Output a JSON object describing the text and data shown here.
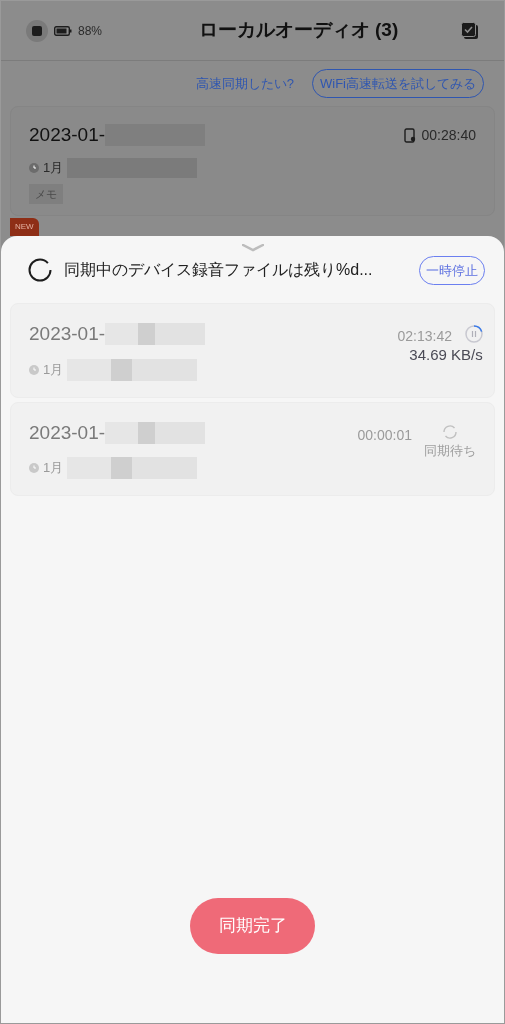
{
  "status": {
    "battery": "88%"
  },
  "header": {
    "title": "ローカルオーディオ (3)"
  },
  "promo": {
    "question": "高速同期したい?",
    "button": "WiFi高速転送を試してみる"
  },
  "recording": {
    "title": "2023-01-",
    "date": "1月",
    "duration": "00:28:40",
    "tag": "メモ",
    "badge": "NEW"
  },
  "sync_sheet": {
    "message": "同期中のデバイス録音ファイルは残り%d...",
    "pause_button": "一時停止",
    "items": [
      {
        "title": "2023-01-",
        "date": "1月",
        "duration": "02:13:42",
        "kind": "syncing",
        "speed": "34.69 KB/s"
      },
      {
        "title": "2023-01-",
        "date": "1月",
        "duration": "00:00:01",
        "kind": "waiting",
        "status": "同期待ち"
      }
    ],
    "done_button": "同期完了"
  }
}
